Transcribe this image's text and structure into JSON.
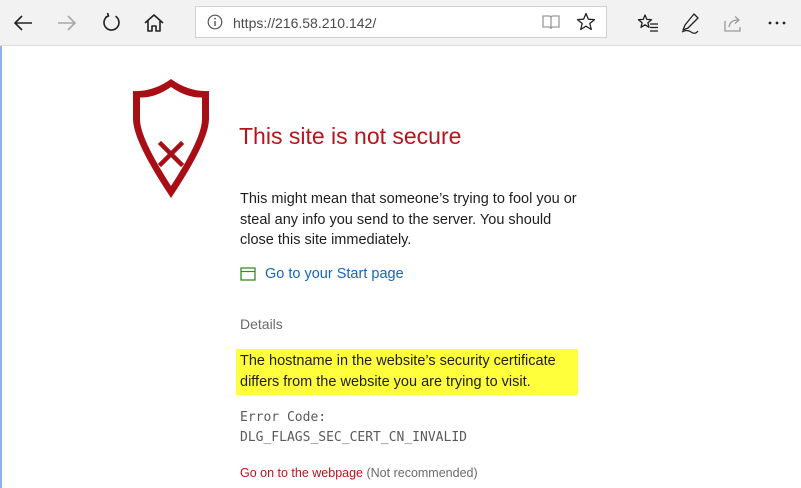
{
  "browser": {
    "address_url": "https://216.58.210.142/",
    "icons": {
      "back": "back-arrow-icon",
      "forward": "forward-arrow-icon",
      "refresh": "refresh-icon",
      "home": "home-icon",
      "info": "info-icon",
      "reading_view": "reading-view-icon",
      "favorite": "star-icon",
      "favorites_hub": "favorites-hub-icon",
      "notes": "pen-icon",
      "share": "share-icon",
      "more": "more-icon"
    }
  },
  "page": {
    "title": "This site is not secure",
    "description": "This might mean that someone’s trying to fool you or steal any info you send to the server. You should close this site immediately.",
    "start_link": "Go to your Start page",
    "details_label": "Details",
    "details_text": "The hostname in the website’s security certificate differs from the website you are trying to visit.",
    "error_code": "Error Code:\nDLG_FLAGS_SEC_CERT_CN_INVALID",
    "go_on_link": "Go on to the webpage",
    "go_on_note": " (Not recommended)"
  },
  "colors": {
    "danger": "#b5161d",
    "link": "#1566b8",
    "highlight": "#ffff3b",
    "start_icon": "#3a8a2a"
  }
}
